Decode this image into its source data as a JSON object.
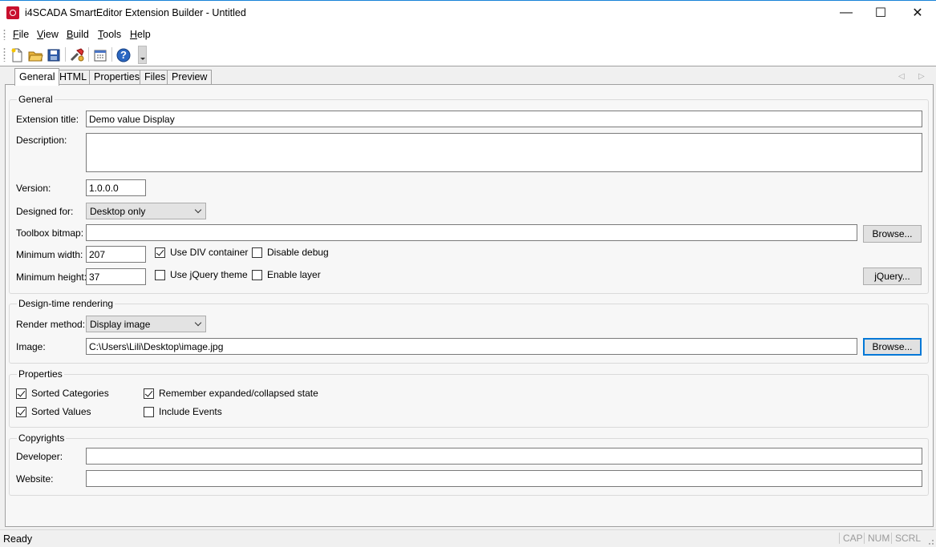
{
  "window": {
    "title": "i4SCADA SmartEditor Extension Builder - Untitled",
    "minimize_glyph": "—",
    "maximize_glyph": "☐",
    "close_glyph": "✕"
  },
  "menu": [
    {
      "label_pre": "",
      "mnemonic": "F",
      "label_post": "ile"
    },
    {
      "label_pre": "",
      "mnemonic": "V",
      "label_post": "iew"
    },
    {
      "label_pre": "",
      "mnemonic": "B",
      "label_post": "uild"
    },
    {
      "label_pre": "",
      "mnemonic": "T",
      "label_post": "ools"
    },
    {
      "label_pre": "",
      "mnemonic": "H",
      "label_post": "elp"
    }
  ],
  "toolbar": {
    "icons": [
      "new-file-icon",
      "open-folder-icon",
      "save-icon",
      "build-icon",
      "calendar-icon",
      "help-icon"
    ],
    "help_glyph": "?"
  },
  "tabs": [
    "General",
    "HTML",
    "Properties",
    "Files",
    "Preview"
  ],
  "tab_nav": {
    "prev": "◁",
    "next": "▷"
  },
  "general": {
    "legend": "General",
    "extension_title_label": "Extension title:",
    "extension_title_value": "Demo value Display",
    "description_label": "Description:",
    "description_value": "",
    "version_label": "Version:",
    "version_value": "1.0.0.0",
    "designed_for_label": "Designed for:",
    "designed_for_value": "Desktop only",
    "toolbox_bitmap_label": "Toolbox bitmap:",
    "toolbox_bitmap_value": "",
    "browse_label": "Browse...",
    "min_width_label": "Minimum width:",
    "min_width_value": "207",
    "min_height_label": "Minimum height:",
    "min_height_value": "37",
    "use_div_container": "Use DIV container",
    "disable_debug": "Disable debug",
    "use_jquery_theme": "Use jQuery theme",
    "enable_layer": "Enable layer",
    "jquery_button": "jQuery..."
  },
  "design_time": {
    "legend": "Design-time rendering",
    "render_method_label": "Render method:",
    "render_method_value": "Display image",
    "image_label": "Image:",
    "image_value": "C:\\Users\\Lili\\Desktop\\image.jpg",
    "browse_label": "Browse..."
  },
  "properties": {
    "legend": "Properties",
    "sorted_categories": "Sorted Categories",
    "sorted_values": "Sorted Values",
    "remember_state": "Remember expanded/collapsed state",
    "include_events": "Include Events"
  },
  "copyrights": {
    "legend": "Copyrights",
    "developer_label": "Developer:",
    "developer_value": "",
    "website_label": "Website:",
    "website_value": ""
  },
  "status": {
    "text": "Ready",
    "cap": "CAP",
    "num": "NUM",
    "scrl": "SCRL"
  },
  "colors": {
    "accent": "#0078d7",
    "title_border": "#1883d7",
    "app_icon": "#c8102e"
  }
}
